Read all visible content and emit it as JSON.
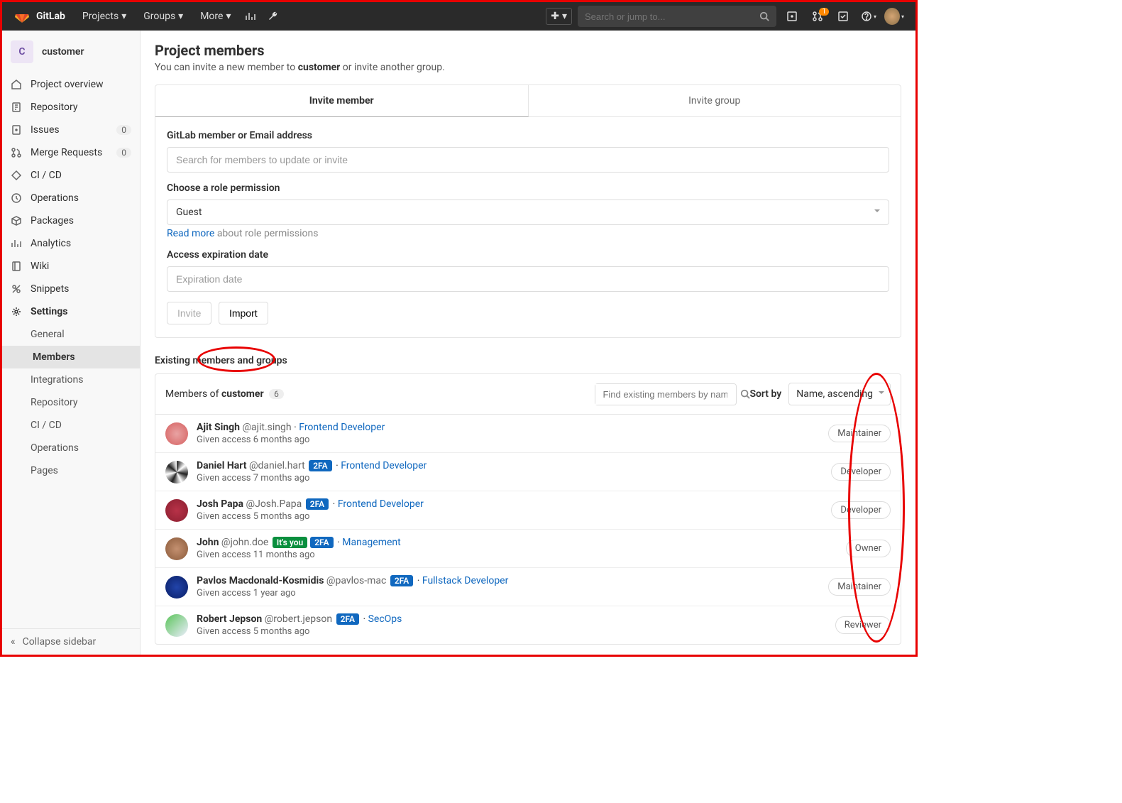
{
  "header": {
    "nav": [
      "Projects",
      "Groups",
      "More"
    ],
    "search_placeholder": "Search or jump to...",
    "mr_count": "1"
  },
  "project": {
    "initial": "C",
    "name": "customer"
  },
  "sidebar": {
    "items": [
      {
        "label": "Project overview"
      },
      {
        "label": "Repository"
      },
      {
        "label": "Issues",
        "count": "0"
      },
      {
        "label": "Merge Requests",
        "count": "0"
      },
      {
        "label": "CI / CD"
      },
      {
        "label": "Operations"
      },
      {
        "label": "Packages"
      },
      {
        "label": "Analytics"
      },
      {
        "label": "Wiki"
      },
      {
        "label": "Snippets"
      },
      {
        "label": "Settings"
      }
    ],
    "settings_sub": [
      "General",
      "Members",
      "Integrations",
      "Repository",
      "CI / CD",
      "Operations",
      "Pages"
    ],
    "collapse": "Collapse sidebar"
  },
  "page": {
    "title": "Project members",
    "desc_pre": "You can invite a new member to ",
    "desc_proj": "customer",
    "desc_post": " or invite another group."
  },
  "tabs": {
    "invite_member": "Invite member",
    "invite_group": "Invite group"
  },
  "form": {
    "member_label": "GitLab member or Email address",
    "member_placeholder": "Search for members to update or invite",
    "role_label": "Choose a role permission",
    "role_value": "Guest",
    "readmore_link": "Read more",
    "readmore_rest": " about role permissions",
    "exp_label": "Access expiration date",
    "exp_placeholder": "Expiration date",
    "invite_btn": "Invite",
    "import_btn": "Import"
  },
  "existing": {
    "heading": "Existing members and groups",
    "members_of_pre": "Members of ",
    "members_of_proj": "customer",
    "count": "6",
    "search_placeholder": "Find existing members by nam",
    "sort_by": "Sort by",
    "sort_value": "Name, ascending"
  },
  "members": [
    {
      "name": "Ajit Singh",
      "handle": "@ajit.singh",
      "twofa": false,
      "you": false,
      "title": "Frontend Developer",
      "access": "Given access 6 months ago",
      "role": "Maintainer",
      "avatar_bg": "radial-gradient(circle,#e8a3a3,#d66060)"
    },
    {
      "name": "Daniel Hart",
      "handle": "@daniel.hart",
      "twofa": true,
      "you": false,
      "title": "Frontend Developer",
      "access": "Given access 7 months ago",
      "role": "Developer",
      "avatar_bg": "conic-gradient(#222,#fff,#222,#fff,#222,#fff,#222,#fff)"
    },
    {
      "name": "Josh Papa",
      "handle": "@Josh.Papa",
      "twofa": true,
      "you": false,
      "title": "Frontend Developer",
      "access": "Given access 5 months ago",
      "role": "Developer",
      "avatar_bg": "radial-gradient(circle,#b83248,#8b1f30)"
    },
    {
      "name": "John",
      "handle": "@john.doe",
      "twofa": true,
      "you": true,
      "title": "Management",
      "access": "Given access 11 months ago",
      "role": "Owner",
      "avatar_bg": "radial-gradient(circle,#c49070,#8a5a3a)"
    },
    {
      "name": "Pavlos Macdonald-Kosmidis",
      "handle": "@pavlos-mac",
      "twofa": true,
      "you": false,
      "title": "Fullstack Developer",
      "access": "Given access 1 year ago",
      "role": "Maintainer",
      "avatar_bg": "radial-gradient(circle,#2244aa,#0a1f66)"
    },
    {
      "name": "Robert Jepson",
      "handle": "@robert.jepson",
      "twofa": true,
      "you": false,
      "title": "SecOps",
      "access": "Given access 5 months ago",
      "role": "Reviewer",
      "avatar_bg": "linear-gradient(135deg,#5ac45a,#eef)"
    }
  ],
  "chips": {
    "twofa": "2FA",
    "you": "It's you"
  }
}
